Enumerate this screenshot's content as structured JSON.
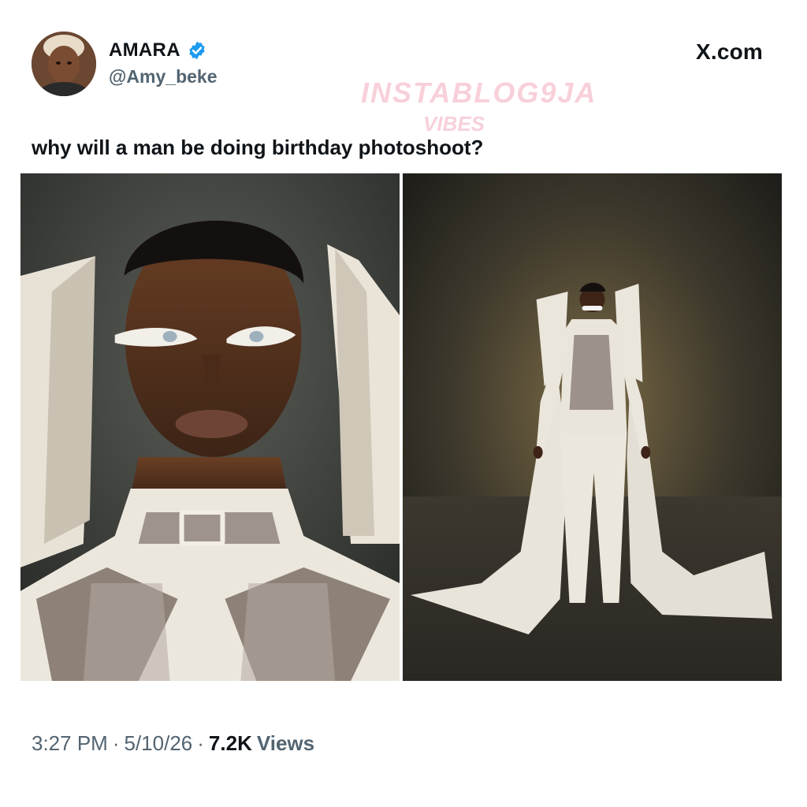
{
  "user": {
    "display_name": "AMARA",
    "handle": "@Amy_beke",
    "verified": true,
    "verified_color": "#1d9bf0"
  },
  "brand": {
    "site_label": "X.com"
  },
  "watermark": {
    "line1": "INSTABLOG9JA",
    "line2": "VIBES",
    "color": "#ec7891"
  },
  "tweet": {
    "text": "why will a man be doing birthday photoshoot?"
  },
  "media": [
    {
      "icon": "portrait-closeup-photo"
    },
    {
      "icon": "full-body-fashion-photo"
    }
  ],
  "footer": {
    "time": "3:27 PM",
    "date": "5/10/26",
    "views_count": "7.2K",
    "views_label": "Views"
  }
}
